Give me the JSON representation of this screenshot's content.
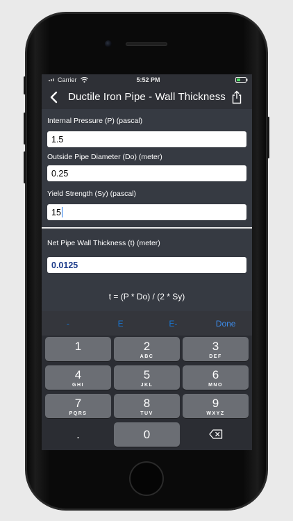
{
  "status_bar": {
    "carrier": "Carrier",
    "time": "5:52 PM"
  },
  "nav": {
    "title": "Ductile Iron Pipe - Wall Thickness"
  },
  "fields": [
    {
      "label": "Internal Pressure (P) (pascal)",
      "value": "1.5"
    },
    {
      "label": "Outside Pipe Diameter (Do) (meter)",
      "value": "0.25"
    },
    {
      "label": "Yield Strength (Sy) (pascal)",
      "value": "15"
    }
  ],
  "result": {
    "label": "Net Pipe Wall Thickness (t) (meter)",
    "value": "0.0125"
  },
  "formula": "t = (P * Do) / (2 * Sy)",
  "accessory": {
    "minus": "-",
    "e": "E",
    "e_minus": "E-",
    "done": "Done"
  },
  "keypad": [
    {
      "digit": "1",
      "letters": ""
    },
    {
      "digit": "2",
      "letters": "ABC"
    },
    {
      "digit": "3",
      "letters": "DEF"
    },
    {
      "digit": "4",
      "letters": "GHI"
    },
    {
      "digit": "5",
      "letters": "JKL"
    },
    {
      "digit": "6",
      "letters": "MNO"
    },
    {
      "digit": "7",
      "letters": "PQRS"
    },
    {
      "digit": "8",
      "letters": "TUV"
    },
    {
      "digit": "9",
      "letters": "WXYZ"
    },
    {
      "digit": ".",
      "letters": ""
    },
    {
      "digit": "0",
      "letters": ""
    }
  ],
  "icons": {
    "back": "chevron-left-icon",
    "share": "share-icon",
    "wifi": "wifi-icon",
    "battery": "battery-icon",
    "backspace": "backspace-icon"
  },
  "colors": {
    "screen_bg": "#363a42",
    "navbar_bg": "#2e3036",
    "accent_blue": "#1976d2",
    "result_text": "#1b3a8a",
    "key_bg": "#6b6e74"
  }
}
